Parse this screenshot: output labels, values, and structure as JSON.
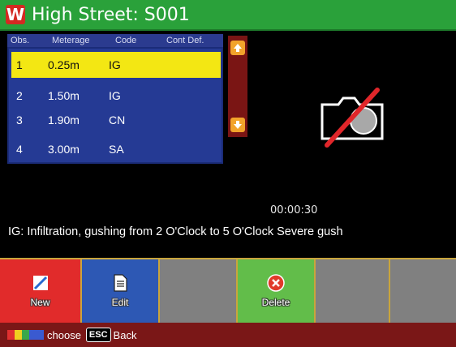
{
  "title": "High Street: S001",
  "obs_header": {
    "obs": "Obs.",
    "meterage": "Meterage",
    "code": "Code",
    "cont_def": "Cont Def."
  },
  "observations": [
    {
      "num": "1",
      "meterage": "0.25m",
      "code": "IG"
    },
    {
      "num": "2",
      "meterage": "1.50m",
      "code": "IG"
    },
    {
      "num": "3",
      "meterage": "1.90m",
      "code": "CN"
    },
    {
      "num": "4",
      "meterage": "3.00m",
      "code": "SA"
    }
  ],
  "selected_index": 0,
  "timer": "00:00:30",
  "description": "IG: Infiltration, gushing from 2 O'Clock to 5 O'Clock Severe gush",
  "actions": {
    "new": "New",
    "edit": "Edit",
    "delete": "Delete"
  },
  "footer": {
    "choose": "choose",
    "esc_key": "ESC",
    "back": "Back"
  },
  "icons": [
    "logo-icon",
    "scroll-up-icon",
    "scroll-down-icon",
    "no-camera-icon",
    "pencil-icon",
    "document-icon",
    "delete-icon"
  ],
  "colors": {
    "title_bar": "#2aa13a",
    "list_bg": "#253a94",
    "selected_row": "#f3e713",
    "new": "#e12b2b",
    "edit": "#2d58b4",
    "delete": "#62bd4a",
    "footer": "#7a1717",
    "key_colors": [
      "#e03030",
      "#f0d020",
      "#3aa84a",
      "#3a5ad0"
    ]
  }
}
